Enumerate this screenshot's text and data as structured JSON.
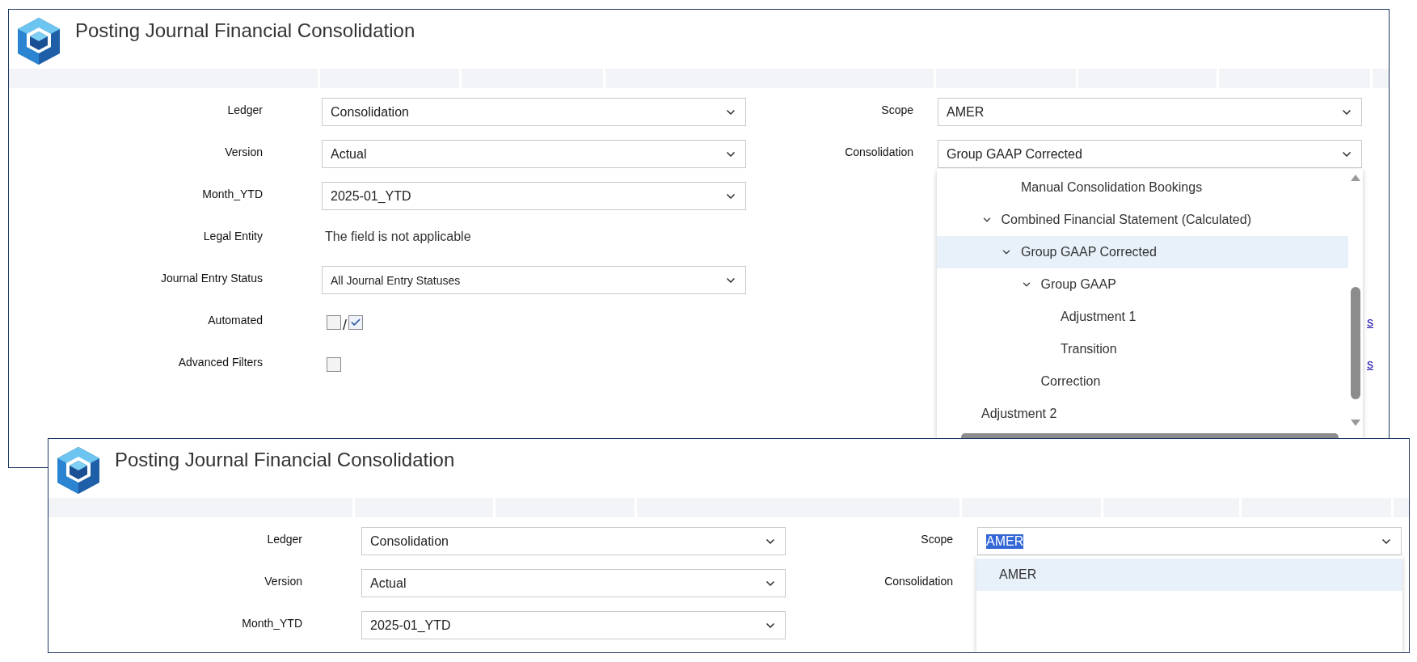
{
  "windows": [
    {
      "title": "Posting Journal Financial Consolidation",
      "filters_left": [
        {
          "label": "Ledger",
          "kind": "select",
          "value": "Consolidation"
        },
        {
          "label": "Version",
          "kind": "select",
          "value": "Actual"
        },
        {
          "label": "Month_YTD",
          "kind": "select",
          "value": "2025-01_YTD"
        },
        {
          "label": "Legal Entity",
          "kind": "text",
          "value": "The field is not applicable"
        },
        {
          "label": "Journal Entry Status",
          "kind": "select",
          "value": "All Journal Entry Statuses"
        },
        {
          "label": "Automated",
          "kind": "checkbox-pair",
          "checks": [
            {
              "checked": false
            },
            {
              "checked": true
            }
          ],
          "separator": "/"
        },
        {
          "label": "Advanced Filters",
          "kind": "checkbox",
          "checked": false
        }
      ],
      "filters_right": [
        {
          "label": "Scope",
          "value": "AMER"
        },
        {
          "label": "Consolidation",
          "value": "Group GAAP Corrected",
          "dropdown": {
            "items": [
              {
                "children": [
                  {
                    "children": [
                      {
                        "label": "Manual Consolidation Bookings",
                        "selected": false
                      }
                    ]
                  },
                  {
                    "label": "Combined Financial Statement (Calculated)",
                    "selected": false,
                    "expanded": true,
                    "children": [
                      {
                        "label": "Group GAAP Corrected",
                        "selected": true,
                        "expanded": true,
                        "children": [
                          {
                            "label": "Group GAAP",
                            "selected": false,
                            "expanded": true,
                            "children": [
                              {
                                "label": "Adjustment 1",
                                "selected": false
                              },
                              {
                                "label": "Transition",
                                "selected": false
                              }
                            ]
                          },
                          {
                            "label": "Correction",
                            "selected": false
                          }
                        ]
                      }
                    ]
                  }
                ]
              },
              {
                "label": "Adjustment 2",
                "selected": false
              }
            ]
          }
        }
      ],
      "links": [
        "s",
        "s"
      ]
    },
    {
      "title": "Posting Journal Financial Consolidation",
      "filters_left": [
        {
          "label": "Ledger",
          "kind": "select",
          "value": "Consolidation"
        },
        {
          "label": "Version",
          "kind": "select",
          "value": "Actual"
        },
        {
          "label": "Month_YTD",
          "kind": "select",
          "value": "2025-01_YTD"
        }
      ],
      "filters_right": [
        {
          "label": "Scope",
          "value": "AMER",
          "text_selected": true,
          "dropdown": {
            "items": [
              {
                "label": "AMER",
                "selected": true
              }
            ]
          }
        },
        {
          "label": "Consolidation"
        }
      ]
    }
  ]
}
